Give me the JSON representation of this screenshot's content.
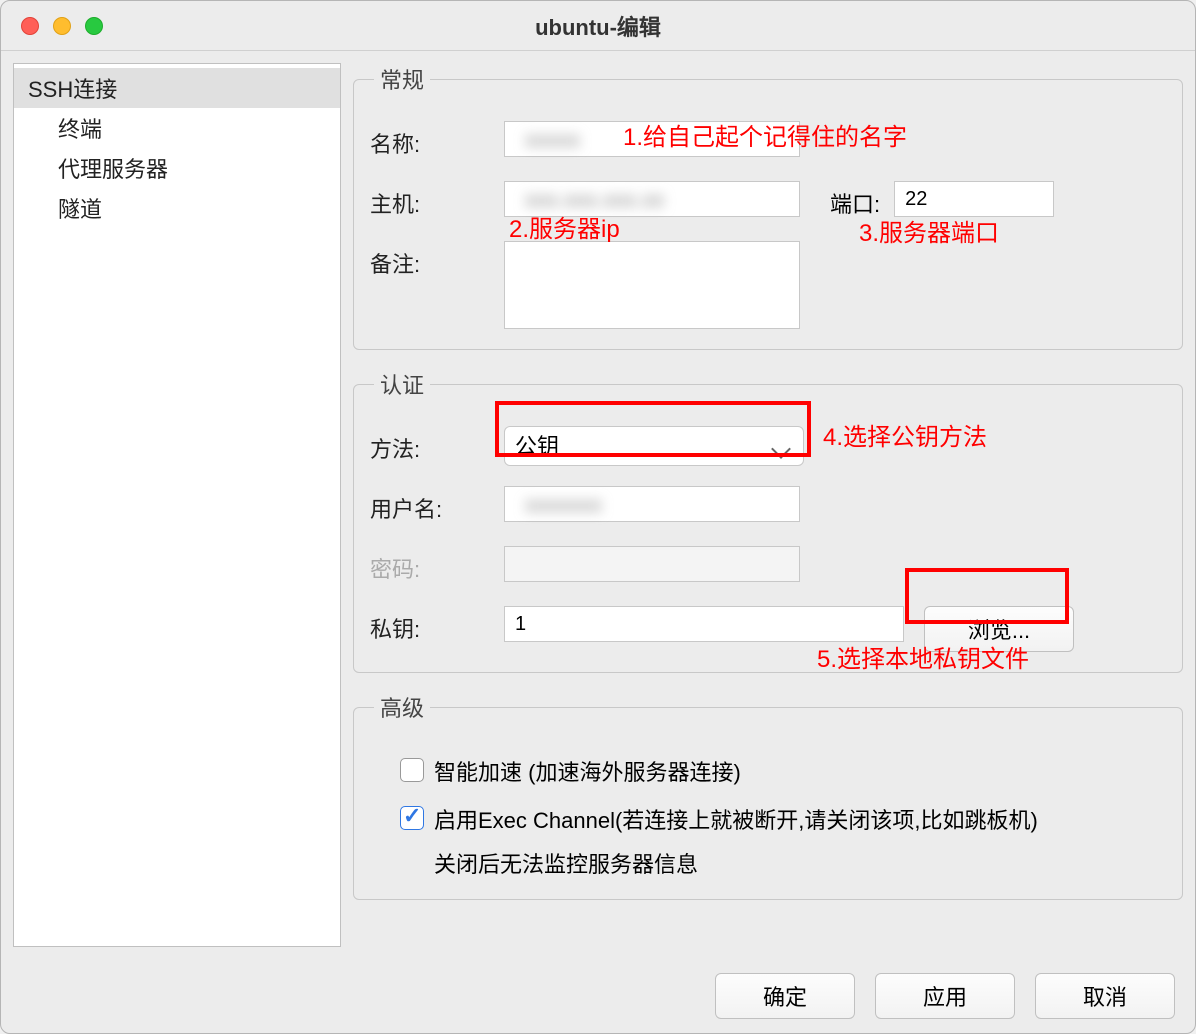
{
  "window": {
    "title": "ubuntu-编辑"
  },
  "sidebar": {
    "items": [
      {
        "label": "SSH连接",
        "selected": true,
        "indent": 0
      },
      {
        "label": "终端",
        "selected": false,
        "indent": 1
      },
      {
        "label": "代理服务器",
        "selected": false,
        "indent": 1
      },
      {
        "label": "隧道",
        "selected": false,
        "indent": 1
      }
    ]
  },
  "general": {
    "legend": "常规",
    "name_label": "名称:",
    "name_value": "xxxxx",
    "host_label": "主机:",
    "host_value": "xxx.xxx.xxx.xx",
    "port_label": "端口:",
    "port_value": "22",
    "remark_label": "备注:",
    "remark_value": ""
  },
  "auth": {
    "legend": "认证",
    "method_label": "方法:",
    "method_value": "公钥",
    "username_label": "用户名:",
    "username_value": "xxxxxxx",
    "password_label": "密码:",
    "password_value": "",
    "privatekey_label": "私钥:",
    "privatekey_value": "1",
    "browse_button": "浏览..."
  },
  "advanced": {
    "legend": "高级",
    "smart_accel_label": "智能加速 (加速海外服务器连接)",
    "exec_channel_label": "启用Exec Channel(若连接上就被断开,请关闭该项,比如跳板机)",
    "exec_channel_note": "关闭后无法监控服务器信息"
  },
  "footer": {
    "ok": "确定",
    "apply": "应用",
    "cancel": "取消"
  },
  "annotations": {
    "a1": "1.给自己起个记得住的名字",
    "a2": "2.服务器ip",
    "a3": "3.服务器端口",
    "a4": "4.选择公钥方法",
    "a5": "5.选择本地私钥文件"
  }
}
